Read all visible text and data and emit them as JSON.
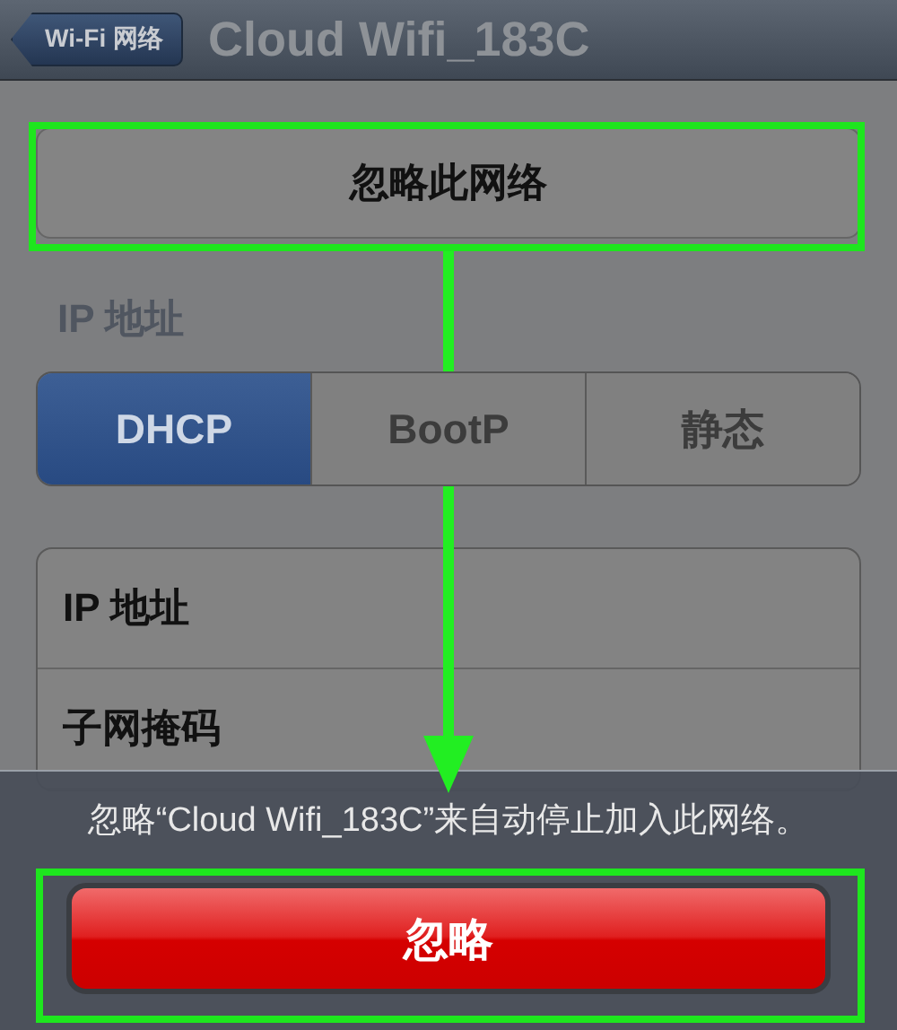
{
  "nav_bar": {
    "back_button": "Wi-Fi 网络",
    "title": "Cloud Wifi_183C"
  },
  "forget_button": "忽略此网络",
  "ip_section": {
    "header": "IP 地址",
    "segments": [
      {
        "label": "DHCP",
        "selected": true
      },
      {
        "label": "BootP",
        "selected": false
      },
      {
        "label": "静态",
        "selected": false
      }
    ],
    "rows": [
      {
        "label": "IP 地址"
      },
      {
        "label": "子网掩码"
      }
    ]
  },
  "action_sheet": {
    "message": "忽略“Cloud Wifi_183C”来自动停止加入此网络。",
    "destructive_button": "忽略"
  }
}
